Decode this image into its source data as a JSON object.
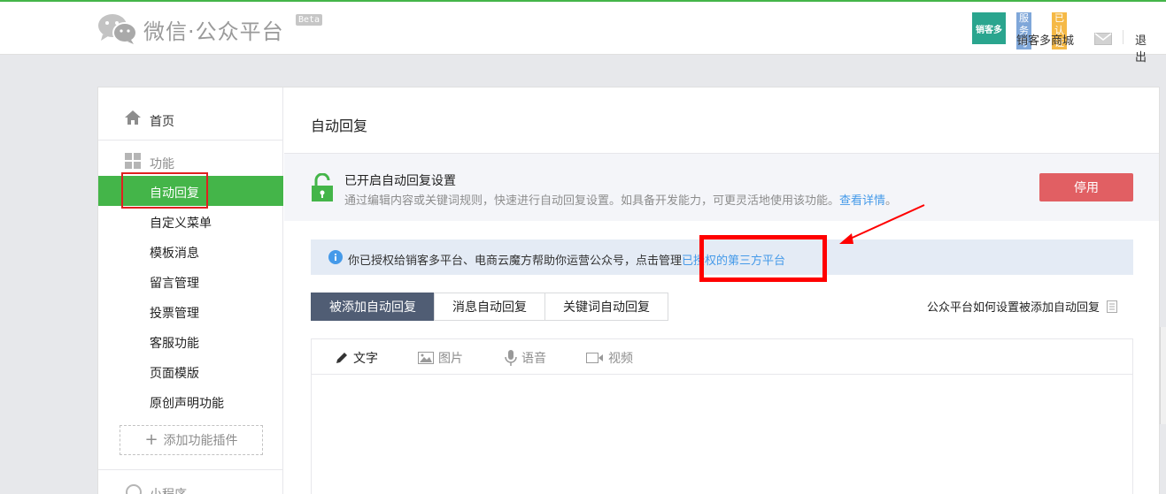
{
  "header": {
    "logo_text": "微信·公众平台",
    "beta": "Beta",
    "account": {
      "avatar_text": "销客多",
      "badge_service": "服务号",
      "badge_verified": "已认证",
      "name": "销客多商城",
      "logout": "退出"
    }
  },
  "sidebar": {
    "home": "首页",
    "group_title": "功能",
    "items": [
      {
        "label": "自动回复"
      },
      {
        "label": "自定义菜单"
      },
      {
        "label": "模板消息"
      },
      {
        "label": "留言管理"
      },
      {
        "label": "投票管理"
      },
      {
        "label": "客服功能"
      },
      {
        "label": "页面模版"
      },
      {
        "label": "原创声明功能"
      }
    ],
    "add_plugin": "添加功能插件",
    "mini_program": "小程序"
  },
  "content": {
    "page_title": "自动回复",
    "status": {
      "title": "已开启自动回复设置",
      "desc": "通过编辑内容或关键词规则，快速进行自动回复设置。如具备开发能力，可更灵活地使用该功能。",
      "desc_link": "查看详情",
      "desc_suffix": "。",
      "stop_button": "停用"
    },
    "notice": {
      "text": "你已授权给销客多平台、电商云魔方帮助你运营公众号，点击管理",
      "link": "已授权的第三方平台"
    },
    "tabs": [
      {
        "label": "被添加自动回复"
      },
      {
        "label": "消息自动回复"
      },
      {
        "label": "关键词自动回复"
      }
    ],
    "help_link": "公众平台如何设置被添加自动回复",
    "editor_tools": [
      {
        "label": "文字",
        "icon": "pencil-icon"
      },
      {
        "label": "图片",
        "icon": "image-icon"
      },
      {
        "label": "语音",
        "icon": "microphone-icon"
      },
      {
        "label": "视频",
        "icon": "video-icon"
      }
    ]
  },
  "colors": {
    "brand_green": "#44b549",
    "danger_red": "#e15f63",
    "link_blue": "#459ae9",
    "tab_active": "#505d74",
    "annotation_red": "#ff0000"
  }
}
